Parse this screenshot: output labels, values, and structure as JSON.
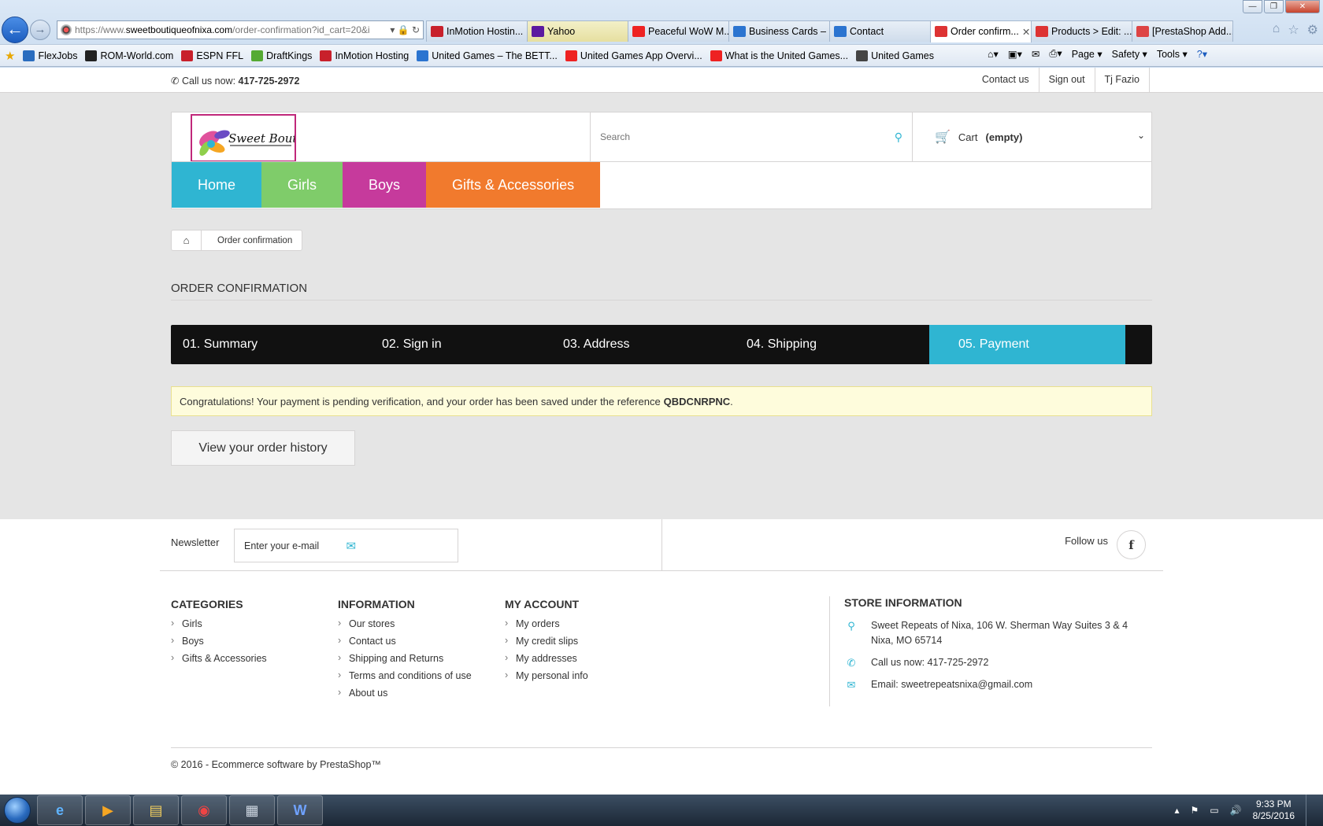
{
  "browser": {
    "url_prefix": "https://www.",
    "url_domain": "sweetboutiqueofnixa.com",
    "url_rest": "/order-confirmation?id_cart=20&i",
    "tabs": [
      {
        "label": "InMotion Hostin...",
        "icon": "inmotion-icon",
        "color": "#c8202b"
      },
      {
        "label": "Yahoo",
        "icon": "yahoo-icon",
        "color": "#5b1aa0"
      },
      {
        "label": "Peaceful WoW M...",
        "icon": "youtube-icon",
        "color": "#e22"
      },
      {
        "label": "Business Cards – ...",
        "icon": "ie-icon",
        "color": "#2b74d0"
      },
      {
        "label": "Contact",
        "icon": "ie-icon",
        "color": "#2b74d0"
      },
      {
        "label": "Order confirm...",
        "icon": "prestashop-icon",
        "color": "#d33"
      },
      {
        "label": "Products > Edit: ...",
        "icon": "prestashop-icon",
        "color": "#d33"
      },
      {
        "label": "[PrestaShop Add...",
        "icon": "gmail-icon",
        "color": "#d44"
      }
    ],
    "favorites": [
      {
        "label": "FlexJobs",
        "icon": "flexjobs-icon",
        "color": "#2a6dbf"
      },
      {
        "label": "ROM-World.com",
        "icon": "romworld-icon",
        "color": "#222"
      },
      {
        "label": "ESPN FFL",
        "icon": "espn-icon",
        "color": "#c8202b"
      },
      {
        "label": "DraftKings",
        "icon": "draftkings-icon",
        "color": "#5a3"
      },
      {
        "label": "InMotion Hosting",
        "icon": "inmotion-icon",
        "color": "#c8202b"
      },
      {
        "label": "United Games – The BETT...",
        "icon": "ie-icon",
        "color": "#2b74d0"
      },
      {
        "label": "United Games App Overvi...",
        "icon": "youtube-icon",
        "color": "#e22"
      },
      {
        "label": "What is the United Games...",
        "icon": "youtube-icon",
        "color": "#e22"
      },
      {
        "label": "United Games",
        "icon": "unitedgames-icon",
        "color": "#444"
      }
    ],
    "commands": {
      "page": "Page",
      "safety": "Safety",
      "tools": "Tools"
    }
  },
  "site": {
    "call_label": "Call us now:",
    "phone": "417-725-2972",
    "top_links": [
      "Contact us",
      "Sign out",
      "Tj Fazio"
    ],
    "logo_text": "Sweet Boutique",
    "search_placeholder": "Search",
    "cart_label": "Cart",
    "cart_status": "(empty)",
    "menu": [
      "Home",
      "Girls",
      "Boys",
      "Gifts & Accessories"
    ],
    "breadcrumb_current": "Order confirmation",
    "page_title": "Order confirmation",
    "steps": [
      "01. Summary",
      "02. Sign in",
      "03. Address",
      "04. Shipping",
      "05. Payment"
    ],
    "alert_text": "Congratulations! Your payment is pending verification, and your order has been saved under the reference",
    "order_reference": "QBDCNRPNC",
    "alert_end": ".",
    "history_button": "View your order history"
  },
  "footer": {
    "newsletter_label": "Newsletter",
    "newsletter_placeholder": "Enter your e-mail",
    "follow_label": "Follow us",
    "categories_title": "Categories",
    "categories": [
      "Girls",
      "Boys",
      "Gifts & Accessories"
    ],
    "information_title": "Information",
    "information": [
      "Our stores",
      "Contact us",
      "Shipping and Returns",
      "Terms and conditions of use",
      "About us"
    ],
    "account_title": "My account",
    "account": [
      "My orders",
      "My credit slips",
      "My addresses",
      "My personal info"
    ],
    "store_title": "Store Information",
    "store_address": "Sweet Repeats of Nixa, 106 W. Sherman Way Suites 3 & 4 Nixa, MO 65714",
    "store_phone": "Call us now: 417-725-2972",
    "store_email": "Email: sweetrepeatsnixa@gmail.com",
    "copyright": "© 2016 - Ecommerce software by PrestaShop™"
  },
  "taskbar": {
    "time": "9:33 PM",
    "date": "8/25/2016",
    "apps": [
      "ie-icon",
      "media-player-icon",
      "file-explorer-icon",
      "chrome-icon",
      "calculator-icon",
      "word-icon"
    ]
  },
  "colors": {
    "accent": "#2fb5d2",
    "girls": "#7fcc6a",
    "boys": "#c63a9c",
    "gifts": "#f17a2d"
  }
}
